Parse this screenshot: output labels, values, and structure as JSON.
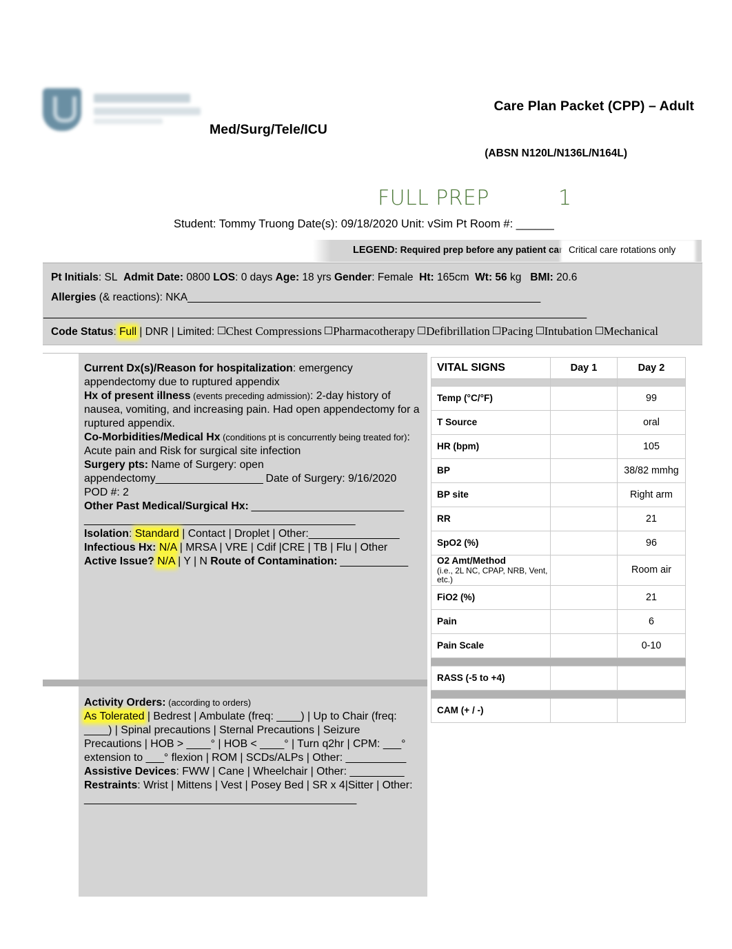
{
  "header": {
    "title": "Care Plan Packet (CPP) – Adult",
    "unit": "Med/Surg/Tele/ICU",
    "course": "(ABSN N120L/N136L/N164L)",
    "prep_label": "FULL PREP",
    "prep_number": "1",
    "student_line": "Student: Tommy Truong Date(s): 09/18/2020 Unit: vSim Pt Room #: ______",
    "prep_color": "#4e7a3a",
    "logo_name": "school-of-nursing-logo"
  },
  "legend": {
    "label": "LEGEND",
    "description": ": Required prep before any patient care",
    "critical_care_note": "Critical care rotations only",
    "band_color": "#d4d4d4"
  },
  "patient_info": {
    "pt_initials_label": "Pt Initials",
    "pt_initials": ": SL",
    "admit_date_label": "Admit Date:",
    "admit_date": " 0800",
    "los_label": "LOS",
    "los": ": 0 days",
    "age_label": "Age:",
    "age": " 18 yrs",
    "gender_label": "Gender",
    "gender": ": Female",
    "ht_label": "Ht:",
    "ht": " 165cm",
    "wt_label": "Wt: 56",
    "wt_unit": " kg",
    "bmi_label": "BMI:",
    "bmi": " 20.6",
    "allergies_label": "Allergies",
    "allergies_sub": " (& reactions): NKA",
    "allergies_blank1": "_______________________________________________________________",
    "allergies_blank2": "_________________________________________________________________________________________________",
    "code_status_label": "Code Status",
    "code_status_colon": ": ",
    "code_status_value": "Full",
    "code_status_options": " | DNR | Limited: ",
    "limited_items": [
      "Chest Compressions",
      "Pharmacotherapy",
      "Defibrillation",
      "Pacing",
      "Intubation",
      "Mechanical"
    ],
    "highlight_color": "#fbf53c"
  },
  "clinical": {
    "dx_label": "Current Dx(s)/Reason for hospitalization",
    "dx_value": ":  emergency appendectomy due to ruptured appendix",
    "hpi_label": "Hx of present illness",
    "hpi_note": " (events preceding admission)",
    "hpi_value": ": 2-day history of nausea, vomiting, and increasing pain. Had open appendectomy for a ruptured appendix.",
    "comorbid_label": "Co-Morbidities/Medical Hx",
    "comorbid_note": " (conditions pt is concurrently being treated for)",
    "comorbid_value": ": Acute pain and Risk for surgical site infection",
    "surgery_label": "Surgery pts:",
    "surgery_name": " Name of Surgery: open appendectomy",
    "surgery_blank": "___________________",
    "surgery_date": " Date of Surgery: 9/16/2020 POD #: 2",
    "other_hx_label": "Other Past Medical/Surgical Hx:",
    "other_hx_blank": "  ___________________________",
    "other_hx_blank2": "________________________________________________",
    "isolation_label": "Isolation",
    "isolation_value": "Standard",
    "isolation_options_pre": ": ",
    "isolation_options_post": " | Contact | Droplet | Other:_______________",
    "infectious_label": "Infectious Hx:",
    "infectious_value": "N/A",
    "infectious_options": " | MRSA | VRE | Cdif  |CRE | TB | Flu | Other",
    "active_issue_label": "Active Issue?",
    "active_issue_value": "N/A",
    "active_issue_options": " | Y | N ",
    "route_label": "Route of Contamination:",
    "route_blank": " ____________"
  },
  "activity": {
    "orders_label": "Activity Orders:",
    "orders_note": " (according to orders)",
    "highlighted_order": "As Tolerated",
    "orders_text": " | Bedrest | Ambulate (freq: ____) | Up to Chair (freq: ____) | Spinal precautions | Sternal Precautions | Seizure Precautions | HOB > ____° | HOB < ____° | Turn q2hr | CPM: ___° extension to ___° flexion | ROM | SCDs/ALPs | Other: __________",
    "assistive_label": "Assistive Devices",
    "assistive_text": ": FWW | Cane | Wheelchair | Other: _________",
    "restraints_label": "Restraints",
    "restraints_text": ": Wrist | Mittens | Vest | Posey Bed | SR x 4|Sitter | Other: _____________________________________________"
  },
  "vitals": {
    "section_title": "VITAL SIGNS",
    "columns": [
      "Day 1",
      "Day 2"
    ],
    "rows": [
      {
        "label": "Temp (°C/°F)",
        "note": "",
        "day1": "",
        "day2": "99"
      },
      {
        "label": "T Source",
        "note": "",
        "day1": "",
        "day2": "oral"
      },
      {
        "label": "HR (bpm)",
        "note": "",
        "day1": "",
        "day2": "105"
      },
      {
        "label": "BP",
        "note": "",
        "day1": "",
        "day2": "38/82 mmhg"
      },
      {
        "label": "BP site",
        "note": "",
        "day1": "",
        "day2": "Right arm"
      },
      {
        "label": "RR",
        "note": "",
        "day1": "",
        "day2": "21"
      },
      {
        "label": "SpO2 (%)",
        "note": "",
        "day1": "",
        "day2": "96"
      },
      {
        "label": "O2 Amt/Method",
        "note": "(i.e., 2L NC, CPAP, NRB, Vent, etc.)",
        "day1": "",
        "day2": "Room air"
      },
      {
        "label": "FiO2 (%)",
        "note": "",
        "day1": "",
        "day2": "21"
      },
      {
        "label": "Pain",
        "note": "",
        "day1": "",
        "day2": "6"
      },
      {
        "label": "Pain Scale",
        "note": "",
        "day1": "",
        "day2": "0-10"
      }
    ],
    "critical_care_rows": [
      {
        "label": "RASS (-5 to +4)",
        "day1": "",
        "day2": ""
      },
      {
        "label": "CAM (+ / -)",
        "day1": "",
        "day2": ""
      }
    ]
  }
}
